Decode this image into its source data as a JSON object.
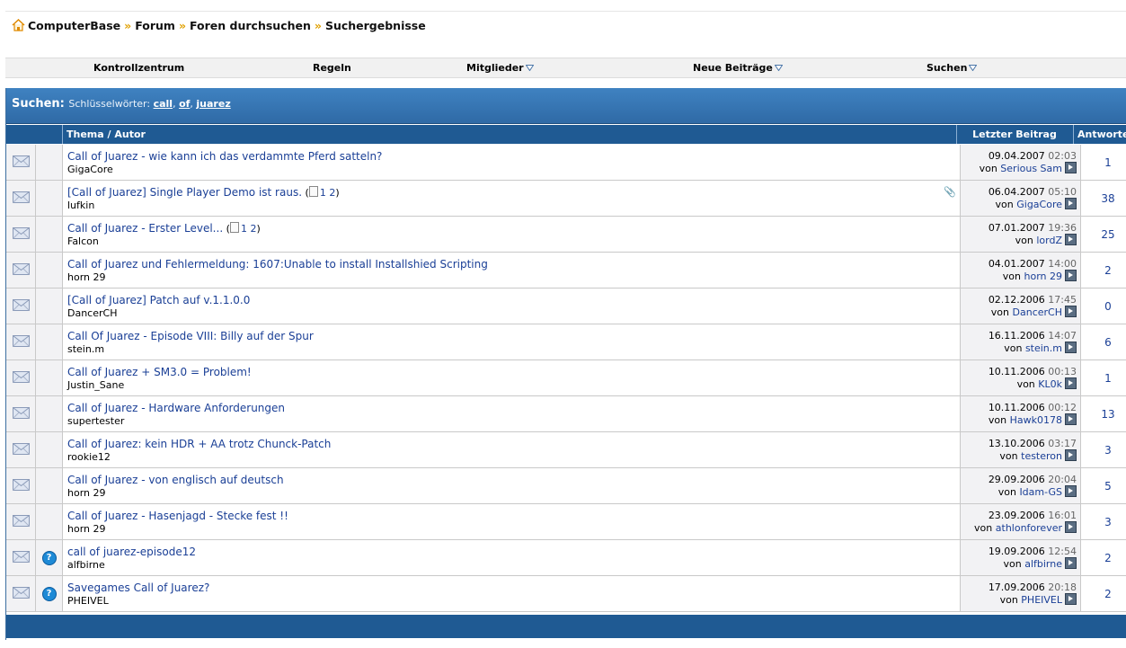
{
  "breadcrumb": {
    "items": [
      "ComputerBase",
      "Forum",
      "Foren durchsuchen",
      "Suchergebnisse"
    ],
    "separator": "»"
  },
  "nav": {
    "items": [
      {
        "label": "Kontrollzentrum"
      },
      {
        "label": "Regeln"
      },
      {
        "label": "Mitglieder"
      },
      {
        "label": "Neue Beiträge"
      },
      {
        "label": "Suchen"
      }
    ]
  },
  "search": {
    "title": "Suchen:",
    "keywords_label": "Schlüsselwörter:",
    "keywords": [
      "call",
      "of",
      "juarez"
    ]
  },
  "columns": {
    "thread": "Thema / Autor",
    "last": "Letzter Beitrag",
    "answers": "Antworten"
  },
  "last_by_label": "von",
  "threads": [
    {
      "title": "Call of Juarez - wie kann ich das verdammte Pferd satteln?",
      "author": "GigaCore",
      "date": "09.04.2007",
      "time": "02:03",
      "last_user": "Serious Sam",
      "answers": "1"
    },
    {
      "title": "[Call of Juarez] Single Player Demo ist raus.",
      "pages": [
        "1",
        "2"
      ],
      "author": "lufkin",
      "date": "06.04.2007",
      "time": "05:10",
      "last_user": "GigaCore",
      "answers": "38",
      "attachment": true
    },
    {
      "title": "Call of Juarez - Erster Level...",
      "pages": [
        "1",
        "2"
      ],
      "author": "Falcon",
      "date": "07.01.2007",
      "time": "19:36",
      "last_user": "lordZ",
      "answers": "25"
    },
    {
      "title": "Call of Juarez und Fehlermeldung: 1607:Unable to install Installshied Scripting",
      "author": "horn 29",
      "date": "04.01.2007",
      "time": "14:00",
      "last_user": "horn 29",
      "answers": "2"
    },
    {
      "title": "[Call of Juarez] Patch auf v.1.1.0.0",
      "author": "DancerCH",
      "date": "02.12.2006",
      "time": "17:45",
      "last_user": "DancerCH",
      "answers": "0"
    },
    {
      "title": "Call Of Juarez - Episode VIII: Billy auf der Spur",
      "author": "stein.m",
      "date": "16.11.2006",
      "time": "14:07",
      "last_user": "stein.m",
      "answers": "6"
    },
    {
      "title": "Call of Juarez + SM3.0 = Problem!",
      "author": "Justin_Sane",
      "date": "10.11.2006",
      "time": "00:13",
      "last_user": "KL0k",
      "answers": "1"
    },
    {
      "title": "Call of Juarez - Hardware Anforderungen",
      "author": "supertester",
      "date": "10.11.2006",
      "time": "00:12",
      "last_user": "Hawk0178",
      "answers": "13"
    },
    {
      "title": "Call of Juarez: kein HDR + AA trotz Chunck-Patch",
      "author": "rookie12",
      "date": "13.10.2006",
      "time": "03:17",
      "last_user": "testeron",
      "answers": "3"
    },
    {
      "title": "Call of Juarez - von englisch auf deutsch",
      "author": "horn 29",
      "date": "29.09.2006",
      "time": "20:04",
      "last_user": "Idam-GS",
      "answers": "5"
    },
    {
      "title": "Call of Juarez - Hasenjagd - Stecke fest !!",
      "author": "horn 29",
      "date": "23.09.2006",
      "time": "16:01",
      "last_user": "athlonforever",
      "answers": "3"
    },
    {
      "title": "call of juarez-episode12",
      "author": "alfbirne",
      "date": "19.09.2006",
      "time": "12:54",
      "last_user": "alfbirne",
      "answers": "2",
      "question": true
    },
    {
      "title": "Savegames Call of Juarez?",
      "author": "PHEIVEL",
      "date": "17.09.2006",
      "time": "20:18",
      "last_user": "PHEIVEL",
      "answers": "2",
      "question": true
    }
  ],
  "question_icon": "?",
  "colors": {
    "header_blue": "#2f6aa6",
    "column_blue": "#1f5a93",
    "link": "#1a3f96",
    "separator": "#e0a000"
  }
}
